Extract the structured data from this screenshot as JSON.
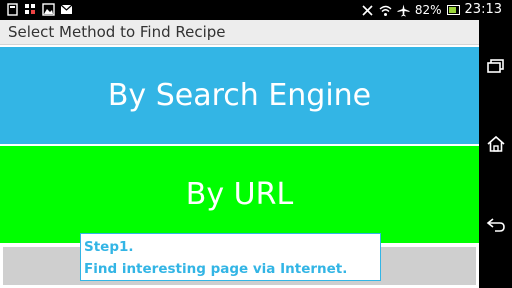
{
  "status_bar": {
    "battery_percent": "82%",
    "time": "23:13",
    "icons": [
      "notification-icon",
      "bbm-icon",
      "image-icon",
      "mail-icon",
      "nfc-icon",
      "wifi-icon",
      "airplane-icon",
      "battery-icon"
    ]
  },
  "app": {
    "title": "Select Method to Find Recipe",
    "search_engine_button": "By Search Engine",
    "url_button": "By URL"
  },
  "tooltip": {
    "line1": "Step1.",
    "line2": "Find interesting page via Internet."
  },
  "nav_bar": {
    "icons": [
      "recent-apps-icon",
      "home-icon",
      "back-icon"
    ]
  },
  "colors": {
    "accent_blue": "#33b5e5",
    "url_green": "#00ff00",
    "title_bar": "#ededed"
  }
}
